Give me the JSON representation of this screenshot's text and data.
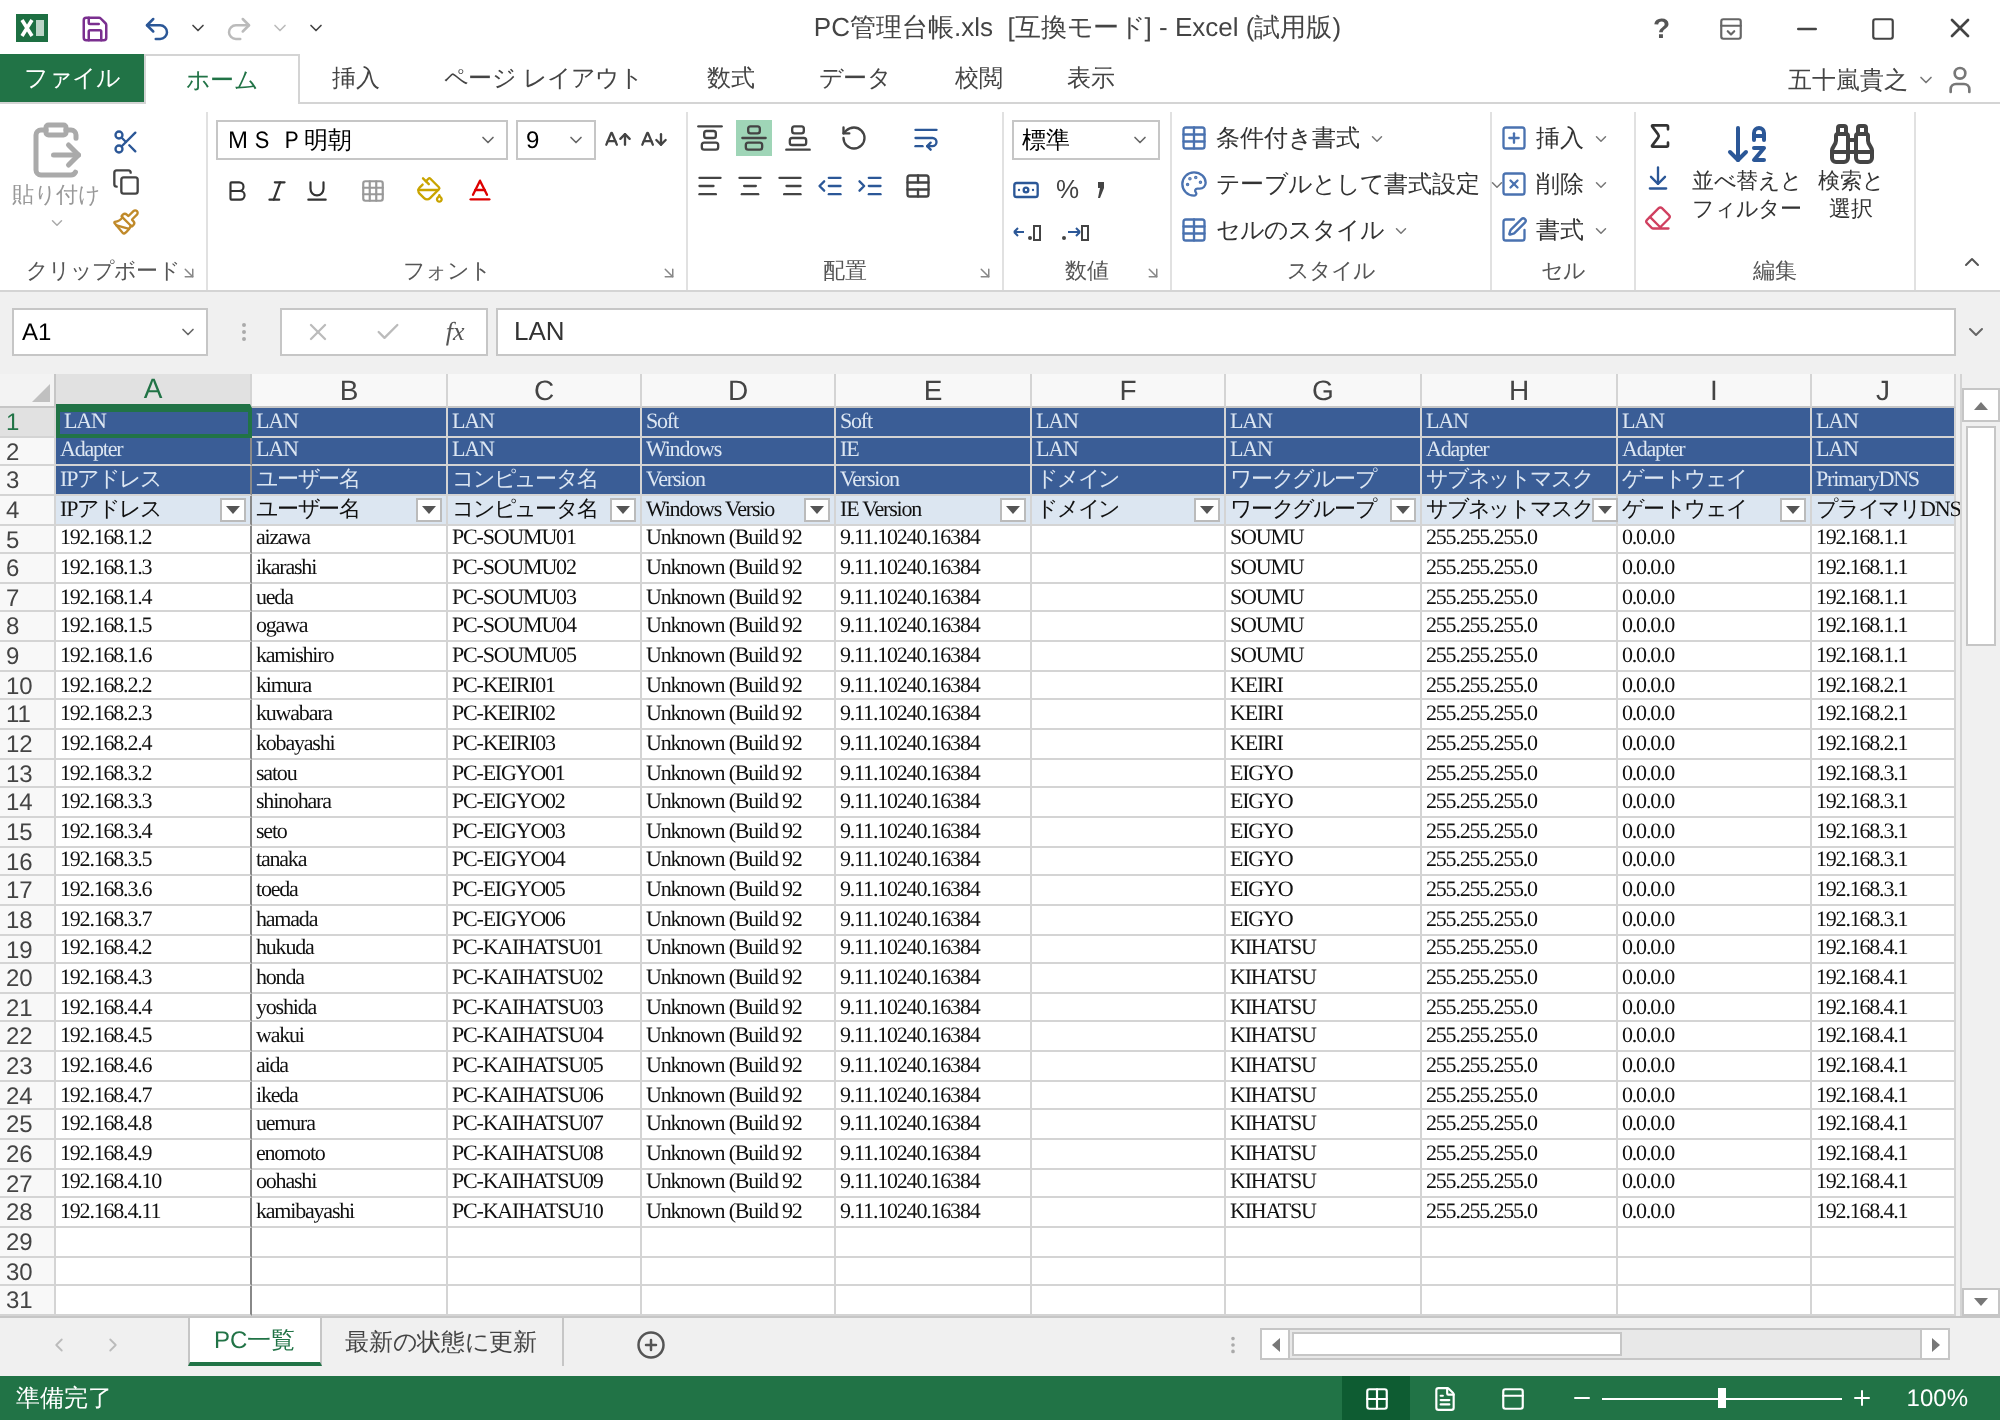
{
  "window": {
    "title": "PC管理台帳.xls  [互換モード] - Excel (試用版)",
    "help": "?",
    "user": "五十嵐貴之"
  },
  "tabs": [
    {
      "label": "ファイル",
      "kind": "file",
      "selected": false
    },
    {
      "label": "ホーム",
      "kind": "tab",
      "selected": true
    },
    {
      "label": "挿入",
      "kind": "tab",
      "selected": false
    },
    {
      "label": "ページ レイアウト",
      "kind": "tab",
      "selected": false
    },
    {
      "label": "数式",
      "kind": "tab",
      "selected": false
    },
    {
      "label": "データ",
      "kind": "tab",
      "selected": false
    },
    {
      "label": "校閲",
      "kind": "tab",
      "selected": false
    },
    {
      "label": "表示",
      "kind": "tab",
      "selected": false
    }
  ],
  "ribbon": {
    "clipboard": {
      "paste": "貼り付け",
      "label": "クリップボード"
    },
    "font": {
      "name": "ＭＳ Ｐ明朝",
      "size": "9",
      "label": "フォント"
    },
    "alignment": {
      "label": "配置"
    },
    "number": {
      "format": "標準",
      "percent": "%",
      "label": "数値"
    },
    "styles": {
      "items": [
        "条件付き書式",
        "テーブルとして書式設定",
        "セルのスタイル"
      ],
      "label": "スタイル"
    },
    "cells": {
      "items": [
        "挿入",
        "削除",
        "書式"
      ],
      "label": "セル"
    },
    "editing": {
      "sort": [
        "並べ替えと",
        "フィルター"
      ],
      "find": [
        "検索と",
        "選択"
      ],
      "label": "編集"
    }
  },
  "formula_bar": {
    "name_box": "A1",
    "fx": "fx",
    "value": "LAN"
  },
  "sheet": {
    "columns": [
      {
        "letter": "A",
        "selected": true
      },
      {
        "letter": "B",
        "selected": false
      },
      {
        "letter": "C",
        "selected": false
      },
      {
        "letter": "D",
        "selected": false
      },
      {
        "letter": "E",
        "selected": false
      },
      {
        "letter": "F",
        "selected": false
      },
      {
        "letter": "G",
        "selected": false
      },
      {
        "letter": "H",
        "selected": false
      },
      {
        "letter": "I",
        "selected": false
      },
      {
        "letter": "J",
        "selected": false
      }
    ],
    "rows": [
      {
        "number": "1",
        "kind": "band",
        "selected": true,
        "cells": [
          "LAN",
          "LAN",
          "LAN",
          "Soft",
          "Soft",
          "LAN",
          "LAN",
          "LAN",
          "LAN",
          "LAN"
        ]
      },
      {
        "number": "2",
        "kind": "band",
        "selected": false,
        "cells": [
          "Adapter",
          "LAN",
          "LAN",
          "Windows",
          "IE",
          "LAN",
          "LAN",
          "Adapter",
          "Adapter",
          "LAN"
        ]
      },
      {
        "number": "3",
        "kind": "band",
        "selected": false,
        "cells": [
          "IPアドレス",
          "ユーザー名",
          "コンピュータ名",
          "Version",
          "Version",
          "ドメイン",
          "ワークグループ",
          "サブネットマスク",
          "ゲートウェイ",
          "PrimaryDNS"
        ]
      },
      {
        "number": "4",
        "kind": "filter",
        "selected": false,
        "cells": [
          "IPアドレス",
          "ユーザー名",
          "コンピュータ名",
          "Windows Versio",
          "IE Version",
          "ドメイン",
          "ワークグループ",
          "サブネットマスク",
          "ゲートウェイ",
          "プライマリDNS"
        ]
      },
      {
        "number": "5",
        "kind": "data",
        "selected": false,
        "cells": [
          "192.168.1.2",
          "aizawa",
          "PC-SOUMU01",
          "Unknown (Build 92",
          "9.11.10240.16384",
          null,
          "SOUMU",
          "255.255.255.0",
          "0.0.0.0",
          "192.168.1.1"
        ]
      },
      {
        "number": "6",
        "kind": "data",
        "selected": false,
        "cells": [
          "192.168.1.3",
          "ikarashi",
          "PC-SOUMU02",
          "Unknown (Build 92",
          "9.11.10240.16384",
          null,
          "SOUMU",
          "255.255.255.0",
          "0.0.0.0",
          "192.168.1.1"
        ]
      },
      {
        "number": "7",
        "kind": "data",
        "selected": false,
        "cells": [
          "192.168.1.4",
          "ueda",
          "PC-SOUMU03",
          "Unknown (Build 92",
          "9.11.10240.16384",
          null,
          "SOUMU",
          "255.255.255.0",
          "0.0.0.0",
          "192.168.1.1"
        ]
      },
      {
        "number": "8",
        "kind": "data",
        "selected": false,
        "cells": [
          "192.168.1.5",
          "ogawa",
          "PC-SOUMU04",
          "Unknown (Build 92",
          "9.11.10240.16384",
          null,
          "SOUMU",
          "255.255.255.0",
          "0.0.0.0",
          "192.168.1.1"
        ]
      },
      {
        "number": "9",
        "kind": "data",
        "selected": false,
        "cells": [
          "192.168.1.6",
          "kamishiro",
          "PC-SOUMU05",
          "Unknown (Build 92",
          "9.11.10240.16384",
          null,
          "SOUMU",
          "255.255.255.0",
          "0.0.0.0",
          "192.168.1.1"
        ]
      },
      {
        "number": "10",
        "kind": "data",
        "selected": false,
        "cells": [
          "192.168.2.2",
          "kimura",
          "PC-KEIRI01",
          "Unknown (Build 92",
          "9.11.10240.16384",
          null,
          "KEIRI",
          "255.255.255.0",
          "0.0.0.0",
          "192.168.2.1"
        ]
      },
      {
        "number": "11",
        "kind": "data",
        "selected": false,
        "cells": [
          "192.168.2.3",
          "kuwabara",
          "PC-KEIRI02",
          "Unknown (Build 92",
          "9.11.10240.16384",
          null,
          "KEIRI",
          "255.255.255.0",
          "0.0.0.0",
          "192.168.2.1"
        ]
      },
      {
        "number": "12",
        "kind": "data",
        "selected": false,
        "cells": [
          "192.168.2.4",
          "kobayashi",
          "PC-KEIRI03",
          "Unknown (Build 92",
          "9.11.10240.16384",
          null,
          "KEIRI",
          "255.255.255.0",
          "0.0.0.0",
          "192.168.2.1"
        ]
      },
      {
        "number": "13",
        "kind": "data",
        "selected": false,
        "cells": [
          "192.168.3.2",
          "satou",
          "PC-EIGYO01",
          "Unknown (Build 92",
          "9.11.10240.16384",
          null,
          "EIGYO",
          "255.255.255.0",
          "0.0.0.0",
          "192.168.3.1"
        ]
      },
      {
        "number": "14",
        "kind": "data",
        "selected": false,
        "cells": [
          "192.168.3.3",
          "shinohara",
          "PC-EIGYO02",
          "Unknown (Build 92",
          "9.11.10240.16384",
          null,
          "EIGYO",
          "255.255.255.0",
          "0.0.0.0",
          "192.168.3.1"
        ]
      },
      {
        "number": "15",
        "kind": "data",
        "selected": false,
        "cells": [
          "192.168.3.4",
          "seto",
          "PC-EIGYO03",
          "Unknown (Build 92",
          "9.11.10240.16384",
          null,
          "EIGYO",
          "255.255.255.0",
          "0.0.0.0",
          "192.168.3.1"
        ]
      },
      {
        "number": "16",
        "kind": "data",
        "selected": false,
        "cells": [
          "192.168.3.5",
          "tanaka",
          "PC-EIGYO04",
          "Unknown (Build 92",
          "9.11.10240.16384",
          null,
          "EIGYO",
          "255.255.255.0",
          "0.0.0.0",
          "192.168.3.1"
        ]
      },
      {
        "number": "17",
        "kind": "data",
        "selected": false,
        "cells": [
          "192.168.3.6",
          "toeda",
          "PC-EIGYO05",
          "Unknown (Build 92",
          "9.11.10240.16384",
          null,
          "EIGYO",
          "255.255.255.0",
          "0.0.0.0",
          "192.168.3.1"
        ]
      },
      {
        "number": "18",
        "kind": "data",
        "selected": false,
        "cells": [
          "192.168.3.7",
          "hamada",
          "PC-EIGYO06",
          "Unknown (Build 92",
          "9.11.10240.16384",
          null,
          "EIGYO",
          "255.255.255.0",
          "0.0.0.0",
          "192.168.3.1"
        ]
      },
      {
        "number": "19",
        "kind": "data",
        "selected": false,
        "cells": [
          "192.168.4.2",
          "hukuda",
          "PC-KAIHATSU01",
          "Unknown (Build 92",
          "9.11.10240.16384",
          null,
          "KIHATSU",
          "255.255.255.0",
          "0.0.0.0",
          "192.168.4.1"
        ]
      },
      {
        "number": "20",
        "kind": "data",
        "selected": false,
        "cells": [
          "192.168.4.3",
          "honda",
          "PC-KAIHATSU02",
          "Unknown (Build 92",
          "9.11.10240.16384",
          null,
          "KIHATSU",
          "255.255.255.0",
          "0.0.0.0",
          "192.168.4.1"
        ]
      },
      {
        "number": "21",
        "kind": "data",
        "selected": false,
        "cells": [
          "192.168.4.4",
          "yoshida",
          "PC-KAIHATSU03",
          "Unknown (Build 92",
          "9.11.10240.16384",
          null,
          "KIHATSU",
          "255.255.255.0",
          "0.0.0.0",
          "192.168.4.1"
        ]
      },
      {
        "number": "22",
        "kind": "data",
        "selected": false,
        "cells": [
          "192.168.4.5",
          "wakui",
          "PC-KAIHATSU04",
          "Unknown (Build 92",
          "9.11.10240.16384",
          null,
          "KIHATSU",
          "255.255.255.0",
          "0.0.0.0",
          "192.168.4.1"
        ]
      },
      {
        "number": "23",
        "kind": "data",
        "selected": false,
        "cells": [
          "192.168.4.6",
          "aida",
          "PC-KAIHATSU05",
          "Unknown (Build 92",
          "9.11.10240.16384",
          null,
          "KIHATSU",
          "255.255.255.0",
          "0.0.0.0",
          "192.168.4.1"
        ]
      },
      {
        "number": "24",
        "kind": "data",
        "selected": false,
        "cells": [
          "192.168.4.7",
          "ikeda",
          "PC-KAIHATSU06",
          "Unknown (Build 92",
          "9.11.10240.16384",
          null,
          "KIHATSU",
          "255.255.255.0",
          "0.0.0.0",
          "192.168.4.1"
        ]
      },
      {
        "number": "25",
        "kind": "data",
        "selected": false,
        "cells": [
          "192.168.4.8",
          "uemura",
          "PC-KAIHATSU07",
          "Unknown (Build 92",
          "9.11.10240.16384",
          null,
          "KIHATSU",
          "255.255.255.0",
          "0.0.0.0",
          "192.168.4.1"
        ]
      },
      {
        "number": "26",
        "kind": "data",
        "selected": false,
        "cells": [
          "192.168.4.9",
          "enomoto",
          "PC-KAIHATSU08",
          "Unknown (Build 92",
          "9.11.10240.16384",
          null,
          "KIHATSU",
          "255.255.255.0",
          "0.0.0.0",
          "192.168.4.1"
        ]
      },
      {
        "number": "27",
        "kind": "data",
        "selected": false,
        "cells": [
          "192.168.4.10",
          "oohashi",
          "PC-KAIHATSU09",
          "Unknown (Build 92",
          "9.11.10240.16384",
          null,
          "KIHATSU",
          "255.255.255.0",
          "0.0.0.0",
          "192.168.4.1"
        ]
      },
      {
        "number": "28",
        "kind": "data",
        "selected": false,
        "cells": [
          "192.168.4.11",
          "kamibayashi",
          "PC-KAIHATSU10",
          "Unknown (Build 92",
          "9.11.10240.16384",
          null,
          "KIHATSU",
          "255.255.255.0",
          "0.0.0.0",
          "192.168.4.1"
        ]
      },
      {
        "number": "29",
        "kind": "empty",
        "selected": false
      },
      {
        "number": "30",
        "kind": "empty",
        "selected": false
      },
      {
        "number": "31",
        "kind": "empty",
        "selected": false
      }
    ]
  },
  "sheet_tabs": [
    {
      "label": "PC一覧",
      "selected": true
    },
    {
      "label": "最新の状態に更新",
      "selected": false
    }
  ],
  "status_bar": {
    "text": "準備完了",
    "views": [
      {
        "kind": "normal",
        "selected": true
      },
      {
        "kind": "page_layout",
        "selected": false
      },
      {
        "kind": "page_break",
        "selected": false
      }
    ],
    "zoom": {
      "level": 0.5,
      "reading": "100%"
    }
  }
}
